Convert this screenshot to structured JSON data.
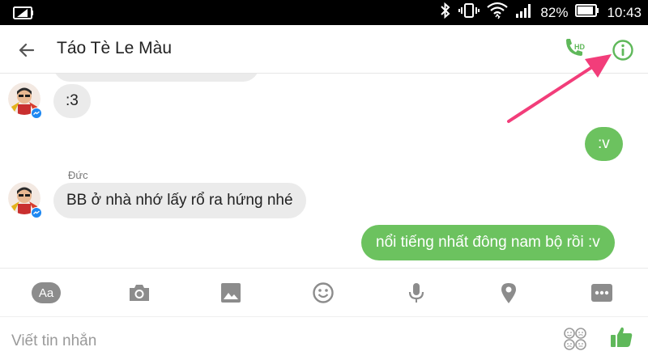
{
  "status_bar": {
    "battery_percent": "82%",
    "time": "10:43"
  },
  "header": {
    "title": "Táo Tè Le Màu",
    "call_badge": "HD",
    "back_icon": "arrow-back-icon",
    "call_icon": "phone-hd-icon",
    "info_icon": "info-icon"
  },
  "messages": [
    {
      "direction": "in",
      "text": ":3"
    },
    {
      "direction": "out",
      "text": ":v"
    },
    {
      "direction": "in",
      "sender": "Đức",
      "text": "BB ở nhà nhớ lấy rổ ra hứng nhé"
    },
    {
      "direction": "out",
      "text": "nổi tiếng nhất đông nam bộ rồi :v"
    }
  ],
  "toolbar": {
    "items": [
      {
        "icon": "text-format-icon",
        "label": "Aa"
      },
      {
        "icon": "camera-icon"
      },
      {
        "icon": "image-icon"
      },
      {
        "icon": "emoji-icon"
      },
      {
        "icon": "microphone-icon"
      },
      {
        "icon": "location-icon"
      },
      {
        "icon": "more-icon"
      }
    ]
  },
  "composer": {
    "placeholder": "Viết tin nhắn",
    "value": ""
  },
  "colors": {
    "accent": "#6cc25f",
    "incoming_bubble": "#ebebeb",
    "annotation_arrow": "#f23d7a",
    "icon_gray": "#8c8c8c"
  }
}
